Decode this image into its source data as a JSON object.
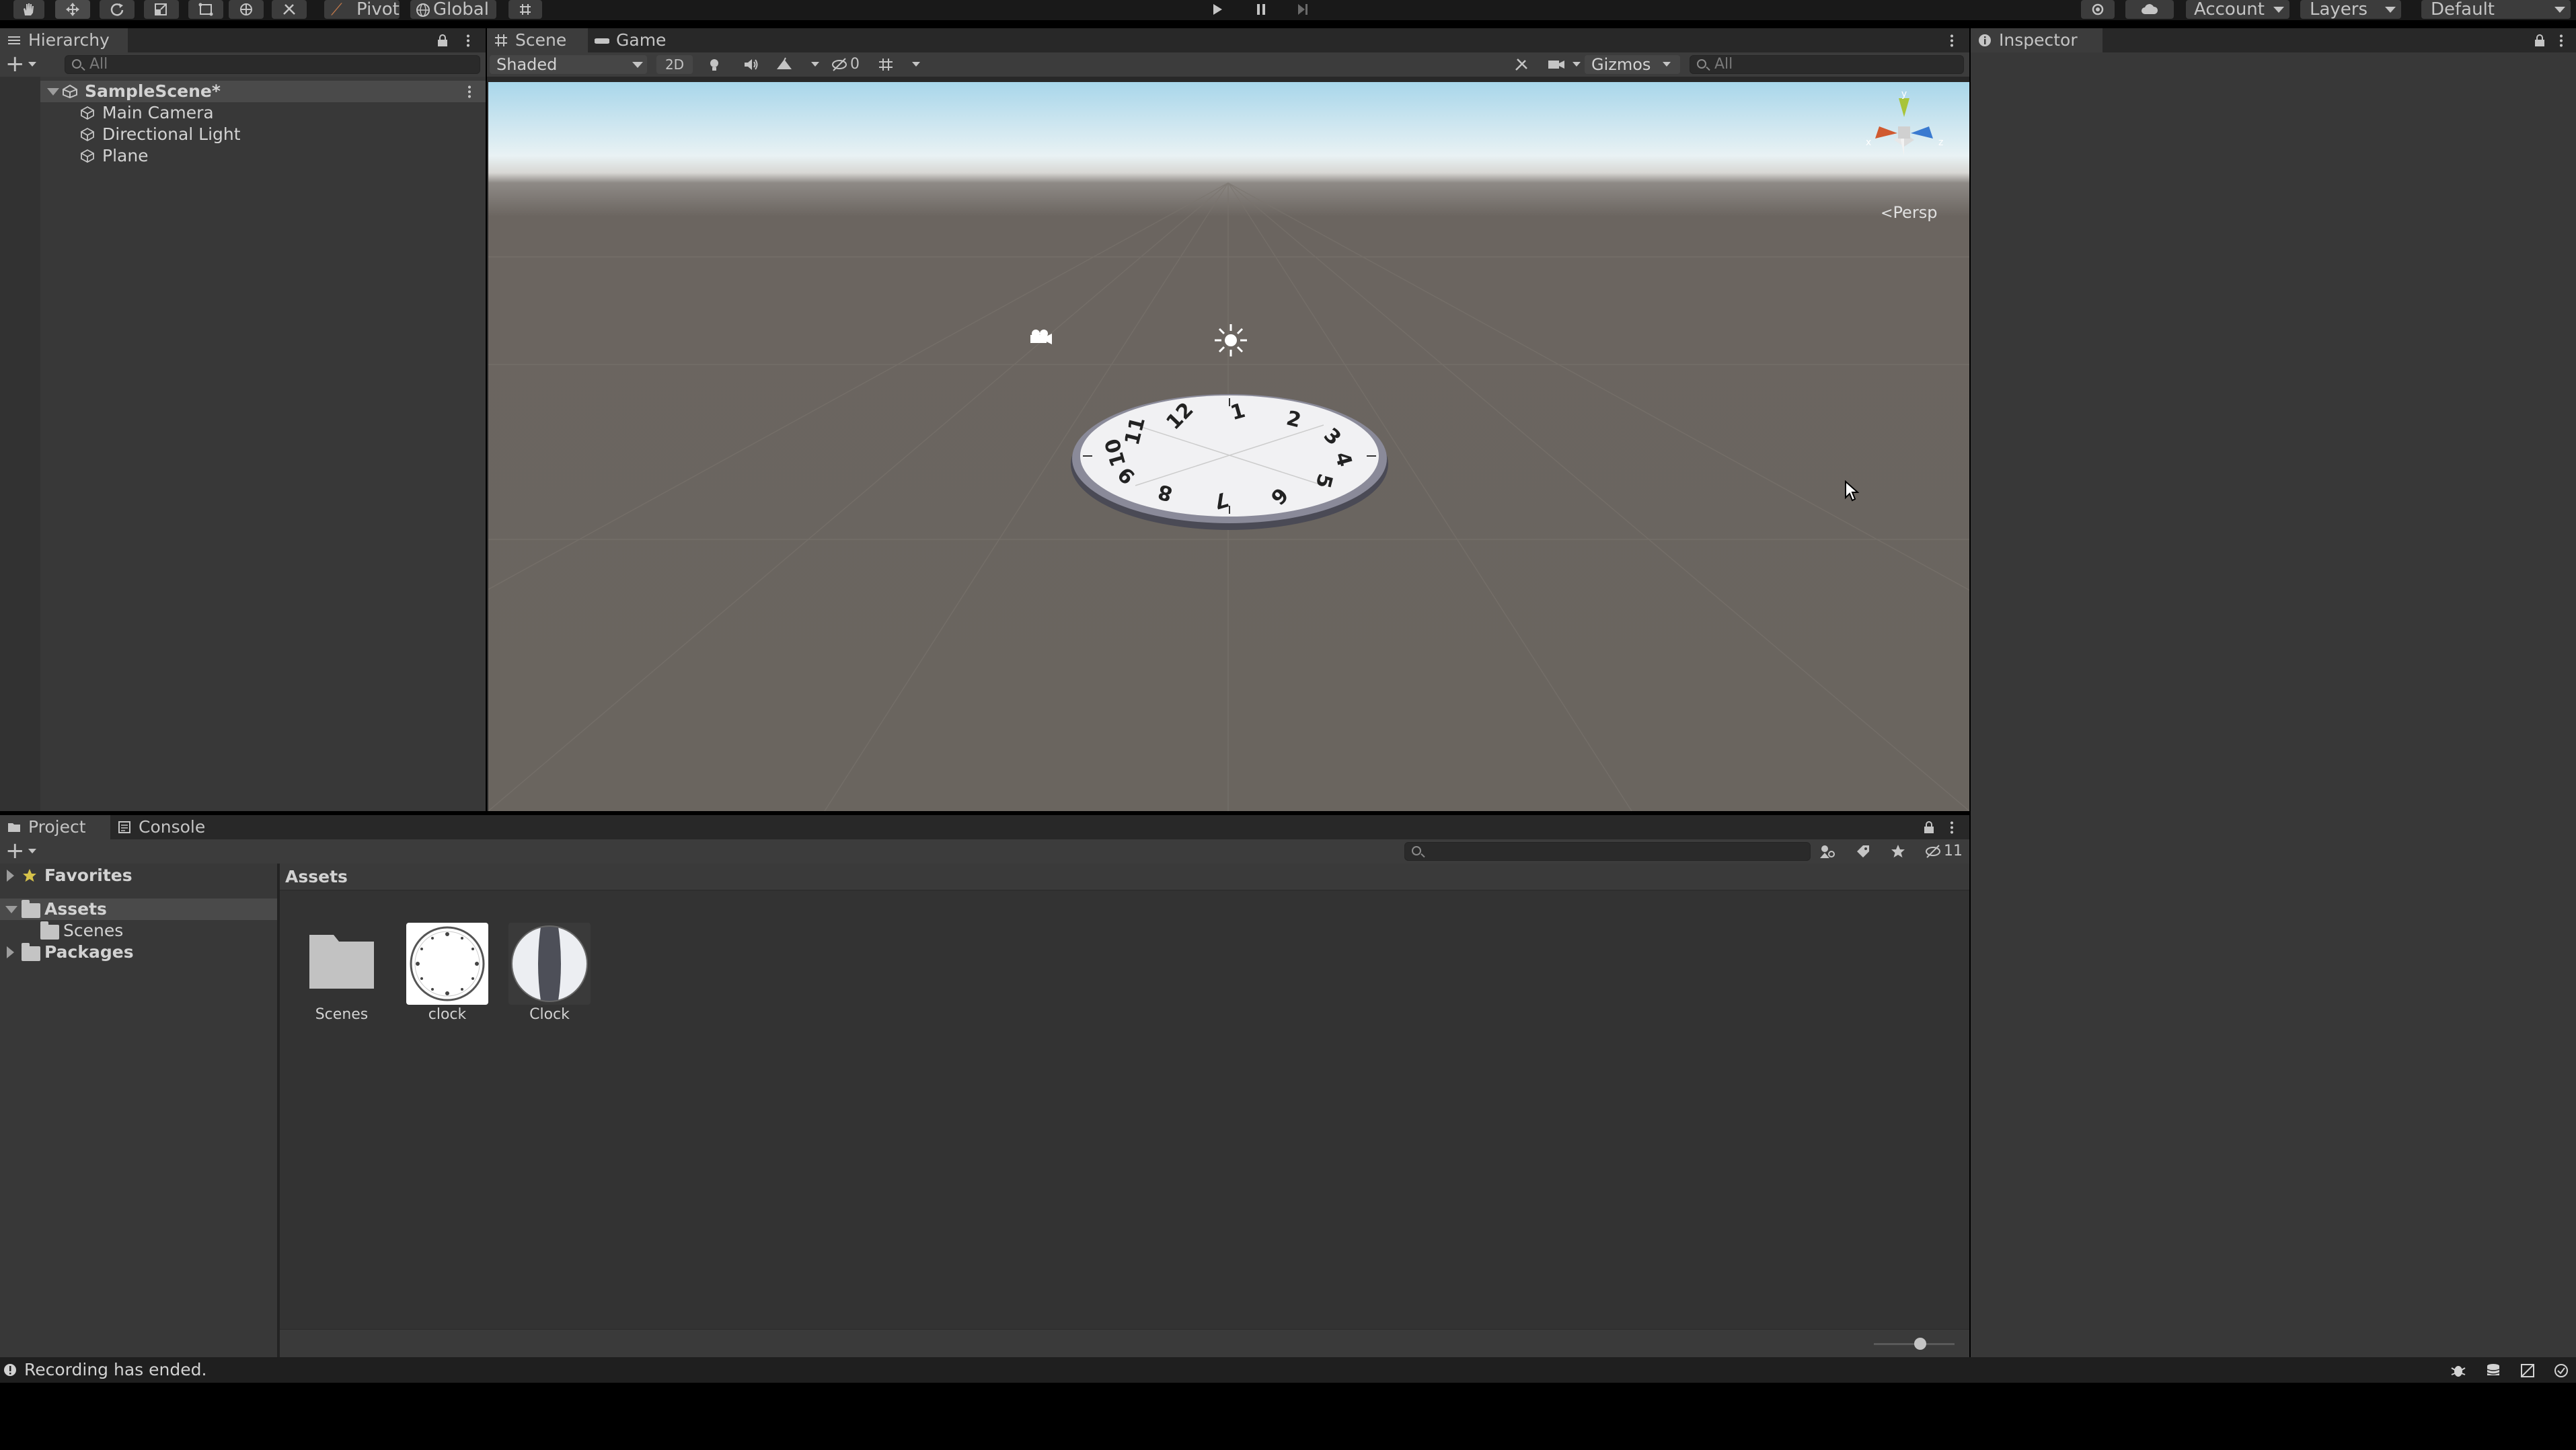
{
  "toolbar": {
    "pivot_label": "Pivot",
    "global_label": "Global",
    "account_label": "Account",
    "layers_label": "Layers",
    "layout_label": "Default",
    "tools": [
      "hand-tool-icon",
      "move-tool-icon",
      "rotate-tool-icon",
      "scale-tool-icon",
      "rect-tool-icon",
      "transform-tool-icon",
      "custom-tool-icon"
    ],
    "play_controls": [
      "play-icon",
      "pause-icon",
      "step-icon"
    ]
  },
  "hierarchy": {
    "tab_label": "Hierarchy",
    "search_placeholder": "All",
    "scene_name": "SampleScene*",
    "items": [
      "Main Camera",
      "Directional Light",
      "Plane"
    ]
  },
  "scene_view": {
    "tabs": [
      "Scene",
      "Game"
    ],
    "shading_mode": "Shaded",
    "mode_2d_label": "2D",
    "hidden_count": "0",
    "gizmos_label": "Gizmos",
    "search_placeholder": "All",
    "projection_label": "Persp",
    "axis_labels": {
      "x": "x",
      "y": "y",
      "z": "z"
    },
    "clock_numbers": [
      "12",
      "1",
      "2",
      "3",
      "4",
      "5",
      "6",
      "7",
      "8",
      "9",
      "10",
      "11"
    ],
    "colors": {
      "sky_top": "#a8d6ea",
      "ground": "#6b6560",
      "gizmo_x": "#d05a30",
      "gizmo_y": "#a8c43a",
      "gizmo_z": "#3a7ad0"
    }
  },
  "inspector": {
    "tab_label": "Inspector"
  },
  "project": {
    "tabs": [
      "Project",
      "Console"
    ],
    "hidden_count": "11",
    "tree": {
      "favorites": "Favorites",
      "assets": "Assets",
      "scenes": "Scenes",
      "packages": "Packages"
    },
    "breadcrumb": "Assets",
    "assets": [
      {
        "name": "Scenes",
        "icon": "folder-icon"
      },
      {
        "name": "clock",
        "icon": "clock-texture-icon"
      },
      {
        "name": "Clock",
        "icon": "clock-material-icon"
      }
    ]
  },
  "status_bar": {
    "message": "Recording has ended."
  }
}
